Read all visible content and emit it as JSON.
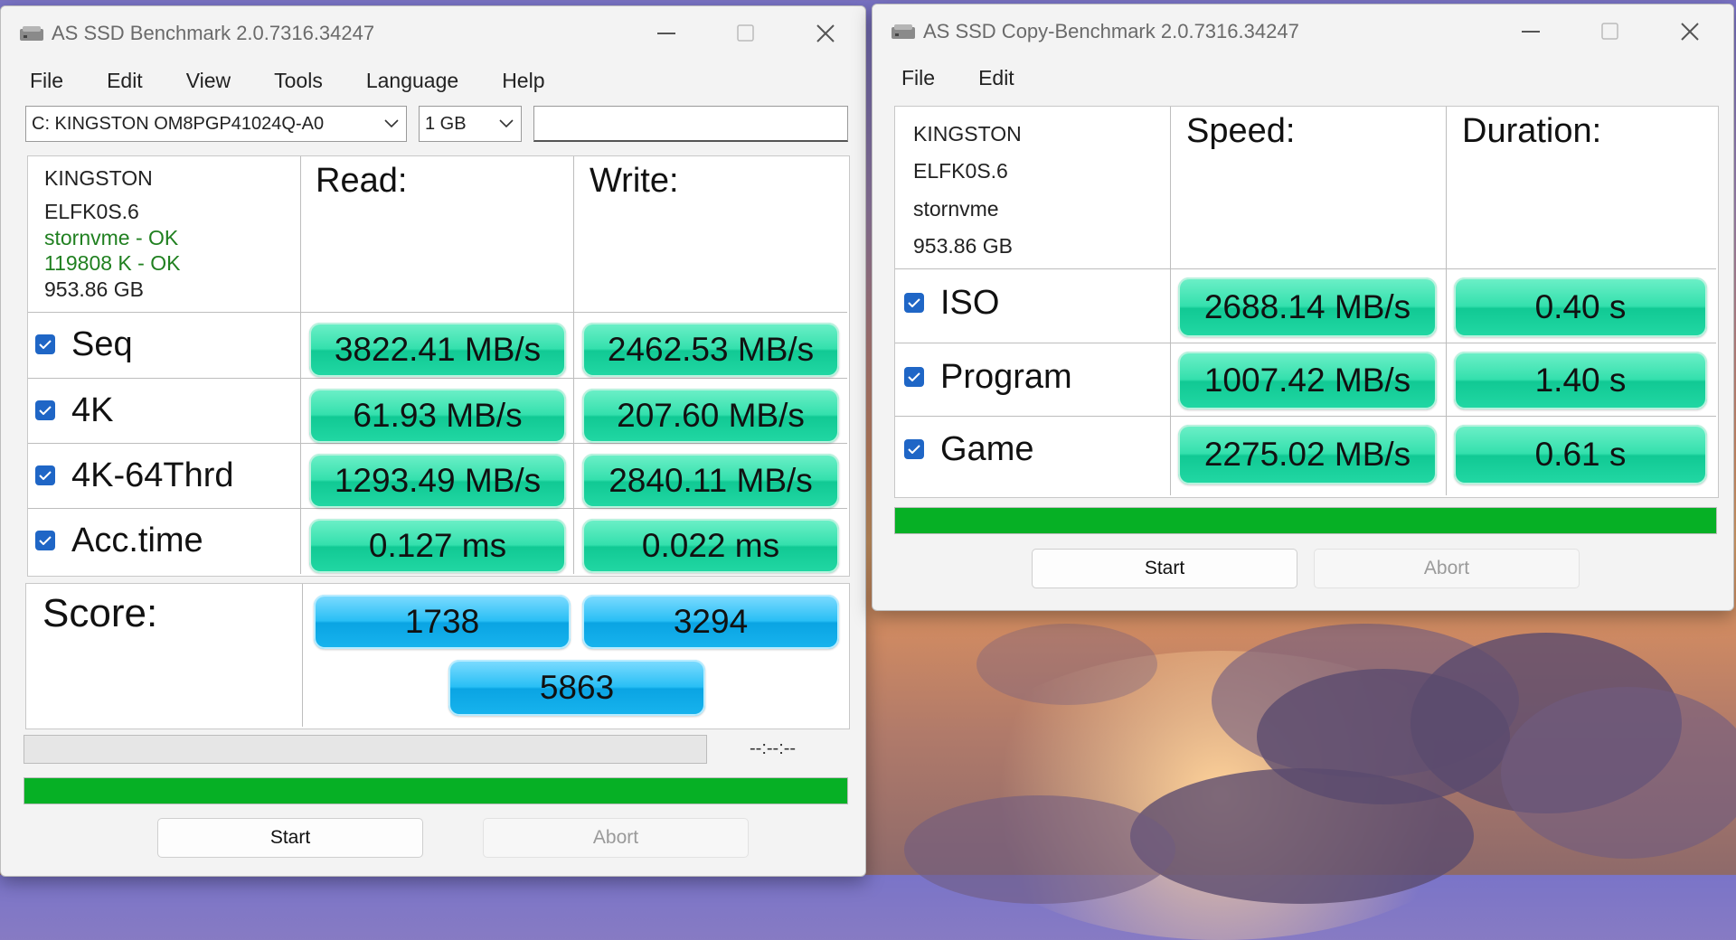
{
  "left": {
    "title": "AS SSD Benchmark 2.0.7316.34247",
    "menu": [
      "File",
      "Edit",
      "View",
      "Tools",
      "Language",
      "Help"
    ],
    "drive_select": "C: KINGSTON OM8PGP41024Q-A0",
    "size_select": "1 GB",
    "info": {
      "model": "KINGSTON",
      "firmware": "ELFK0S.6",
      "driver": "stornvme - OK",
      "align": "119808 K - OK",
      "capacity": "953.86 GB"
    },
    "headers": {
      "read": "Read:",
      "write": "Write:"
    },
    "rows": [
      {
        "label": "Seq",
        "read": "3822.41 MB/s",
        "write": "2462.53 MB/s"
      },
      {
        "label": "4K",
        "read": "61.93 MB/s",
        "write": "207.60 MB/s"
      },
      {
        "label": "4K-64Thrd",
        "read": "1293.49 MB/s",
        "write": "2840.11 MB/s"
      },
      {
        "label": "Acc.time",
        "read": "0.127 ms",
        "write": "0.022 ms"
      }
    ],
    "score_label": "Score:",
    "score": {
      "read": "1738",
      "write": "3294",
      "total": "5863"
    },
    "time": "--:--:--",
    "progress": 1.0,
    "start": "Start",
    "abort": "Abort"
  },
  "right": {
    "title": "AS SSD Copy-Benchmark 2.0.7316.34247",
    "menu": [
      "File",
      "Edit"
    ],
    "info": {
      "model": "KINGSTON",
      "firmware": "ELFK0S.6",
      "driver": "stornvme",
      "capacity": "953.86 GB"
    },
    "headers": {
      "speed": "Speed:",
      "duration": "Duration:"
    },
    "rows": [
      {
        "label": "ISO",
        "speed": "2688.14 MB/s",
        "duration": "0.40 s"
      },
      {
        "label": "Program",
        "speed": "1007.42 MB/s",
        "duration": "1.40 s"
      },
      {
        "label": "Game",
        "speed": "2275.02 MB/s",
        "duration": "0.61 s"
      }
    ],
    "progress": 1.0,
    "start": "Start",
    "abort": "Abort"
  },
  "icons": {
    "app": "drive-icon",
    "checkbox": "checkbox-checked-icon",
    "dropdown": "chevron-down-icon"
  },
  "colors": {
    "result_green": "#22d8a4",
    "score_blue": "#18b4ee",
    "progress_green": "#06b025",
    "info_ok": "#208020"
  }
}
